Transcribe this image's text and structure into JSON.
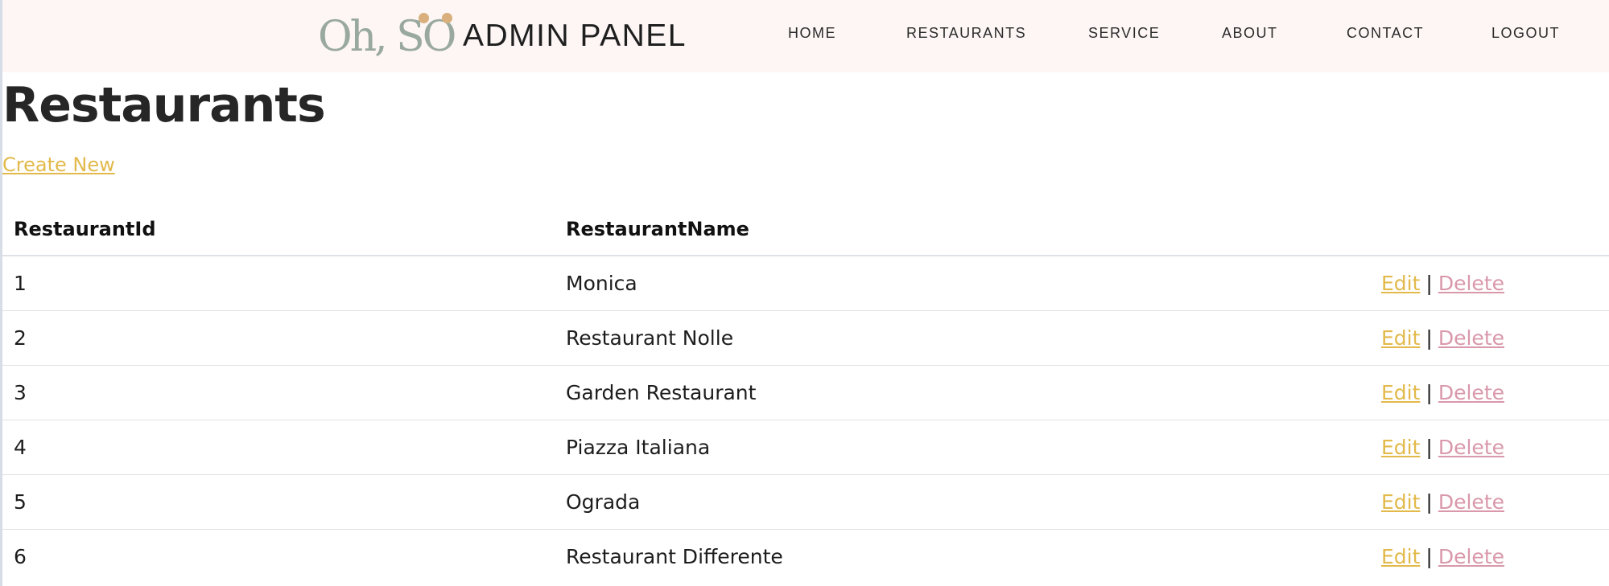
{
  "header": {
    "logo_text": "Oh, SO",
    "title": "ADMIN PANEL",
    "nav": [
      {
        "label": "HOME"
      },
      {
        "label": "RESTAURANTS"
      },
      {
        "label": "SERVICE"
      },
      {
        "label": "ABOUT"
      },
      {
        "label": "CONTACT"
      },
      {
        "label": "LOGOUT"
      }
    ]
  },
  "main": {
    "title": "Restaurants",
    "create_link": "Create New",
    "table": {
      "columns": [
        "RestaurantId",
        "RestaurantName",
        ""
      ],
      "rows": [
        {
          "id": "1",
          "name": "Monica",
          "edit": "Edit",
          "sep": "|",
          "delete": "Delete"
        },
        {
          "id": "2",
          "name": "Restaurant Nolle",
          "edit": "Edit",
          "sep": "|",
          "delete": "Delete"
        },
        {
          "id": "3",
          "name": "Garden Restaurant",
          "edit": "Edit",
          "sep": "|",
          "delete": "Delete"
        },
        {
          "id": "4",
          "name": "Piazza Italiana",
          "edit": "Edit",
          "sep": "|",
          "delete": "Delete"
        },
        {
          "id": "5",
          "name": "Ograda",
          "edit": "Edit",
          "sep": "|",
          "delete": "Delete"
        },
        {
          "id": "6",
          "name": "Restaurant Differente",
          "edit": "Edit",
          "sep": "|",
          "delete": "Delete"
        }
      ]
    }
  },
  "colors": {
    "header_bg": "#fdf6f5",
    "link_gold": "#e2b94a",
    "link_pink": "#d998ab",
    "logo_accent": "#d9b07d"
  }
}
